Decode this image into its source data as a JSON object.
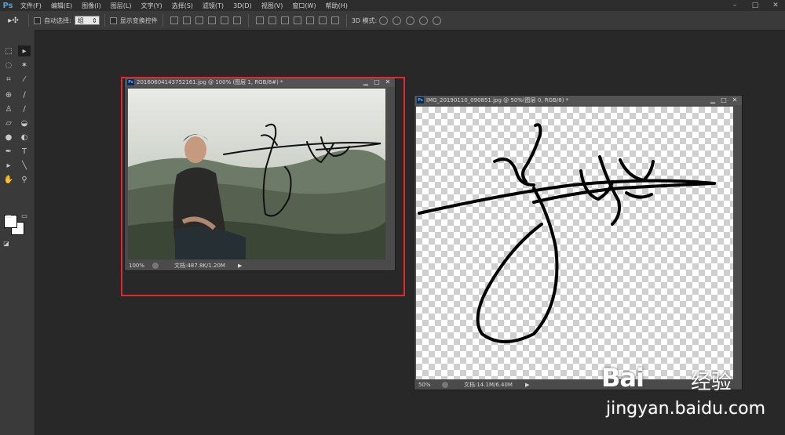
{
  "app": {
    "logo": "Ps"
  },
  "menu": [
    "文件(F)",
    "编辑(E)",
    "图像(I)",
    "图层(L)",
    "文字(Y)",
    "选择(S)",
    "滤镜(T)",
    "3D(D)",
    "视图(V)",
    "窗口(W)",
    "帮助(H)"
  ],
  "window_controls": {
    "minimize": "–",
    "restore": "□",
    "close": "✕"
  },
  "options": {
    "auto_select_label": "自动选择:",
    "auto_select_value": "组",
    "show_transform_label": "显示变换控件",
    "mode3d_label": "3D 模式:"
  },
  "doc1": {
    "title": "20160604143752161.jpg @ 100% (图层 1, RGB/8#) *",
    "zoom": "100%",
    "status": "文档:487.8K/1.20M"
  },
  "doc2": {
    "title": "IMG_20190110_090851.jpg @ 50%(图层 0, RGB/8) *",
    "zoom": "50%",
    "status": "文档:14.1M/6.40M"
  },
  "doc_buttons": {
    "minimize": "▁",
    "restore": "□",
    "close": "✕"
  },
  "icons": [
    "move-tool-icon",
    "marquee-icon",
    "lasso-icon",
    "magic-wand-icon",
    "crop-icon",
    "eyedropper-icon",
    "healing-brush-icon",
    "brush-icon",
    "clone-stamp-icon",
    "history-brush-icon",
    "eraser-icon",
    "paint-bucket-icon",
    "blur-icon",
    "dodge-icon",
    "pen-icon",
    "type-icon",
    "path-select-icon",
    "line-icon",
    "hand-icon",
    "zoom-icon"
  ],
  "watermark": {
    "brand": "Bai",
    "brand_cn": "经验",
    "url": "jingyan.baidu.com"
  },
  "colors": {
    "highlight_border": "#e0282e",
    "app_bg": "#282828"
  }
}
